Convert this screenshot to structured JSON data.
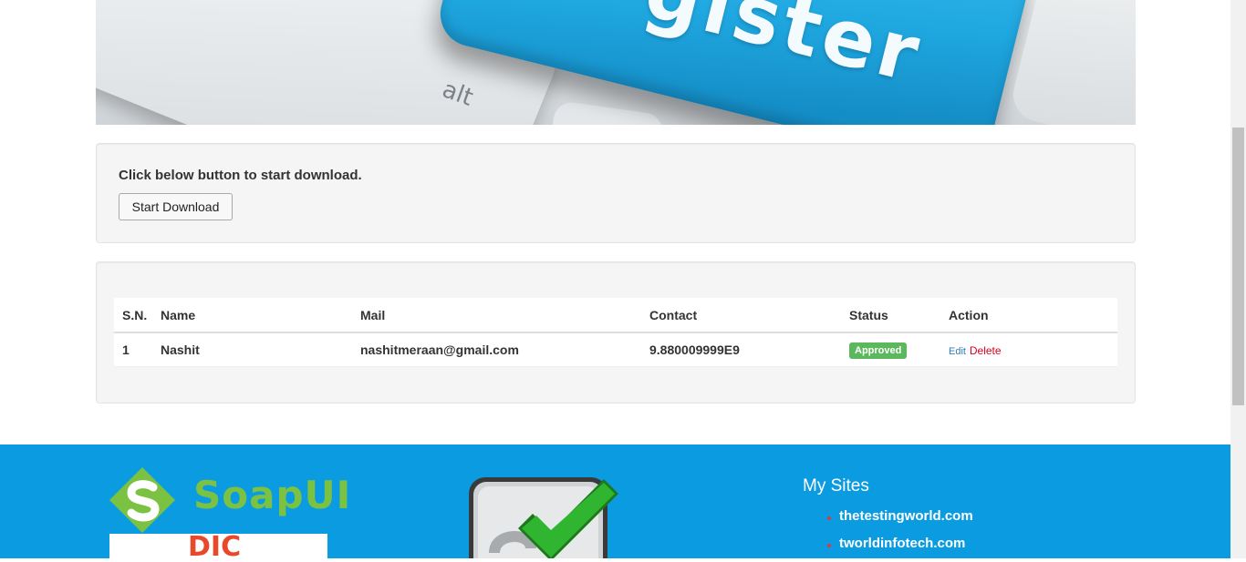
{
  "download": {
    "instruction": "Click below button to start download.",
    "button_label": "Start Download"
  },
  "table": {
    "headers": [
      "S.N.",
      "Name",
      "Mail",
      "Contact",
      "Status",
      "Action"
    ],
    "rows": [
      {
        "sn": "1",
        "name": "Nashit",
        "mail": "nashitmeraan@gmail.com",
        "contact": "9.880009999E9",
        "status": "Approved",
        "edit": "Edit",
        "delete": "Delete"
      }
    ]
  },
  "hero": {
    "key_text": "gister",
    "alt_key": "alt"
  },
  "footer": {
    "soapui_logo_text": "SoapUI",
    "partial_logo_text": "DIC",
    "my_sites_title": "My Sites",
    "sites": [
      "thetestingworld.com",
      "tworldinfotech.com"
    ]
  },
  "colors": {
    "footer_bg": "#0b9be0",
    "badge_approved": "#5cb85c",
    "edit_link": "#337ab7",
    "delete_link": "#d9001b"
  }
}
